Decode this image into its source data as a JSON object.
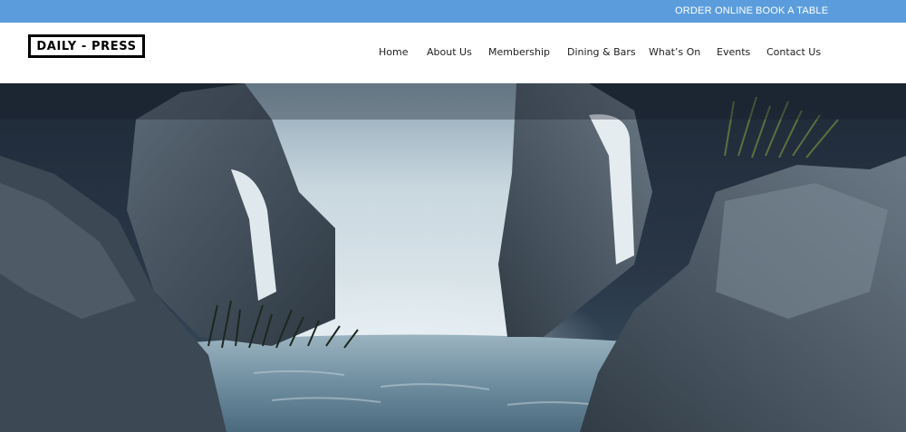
{
  "topbar": {
    "order_online": "ORDER ONLINE",
    "book_table": "BOOK A TABLE",
    "background_color": "#5b9ddc"
  },
  "header": {
    "logo_text": "DAILY - PRESS",
    "nav": {
      "home": "Home",
      "about": "About Us",
      "membership": "Membership",
      "dining": "Dining & Bars",
      "whats_on": "What’s On",
      "events": "Events",
      "contact": "Contact Us"
    }
  },
  "hero": {
    "palette": {
      "sky": "#1f2a38",
      "rock": "#4a5866",
      "water": "#6f8ea0",
      "falls": "#d9e4ea"
    }
  }
}
